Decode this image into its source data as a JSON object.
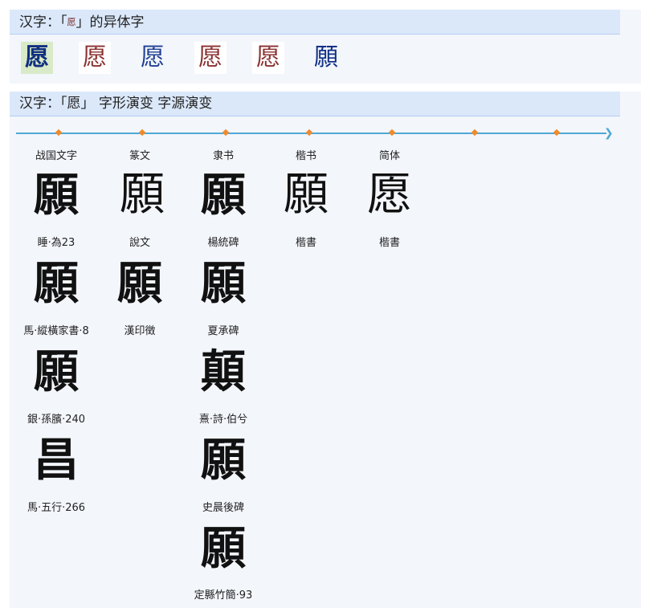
{
  "variants_section": {
    "title_prefix": "汉字：「",
    "title_char": "愿",
    "title_suffix": "」的异体字",
    "variants": [
      "愿",
      "愿",
      "愿",
      "愿",
      "愿",
      "願"
    ]
  },
  "evolution_section": {
    "title": "汉字：「愿」 字形演变 字源演变",
    "timeline_stops": 7,
    "eras": [
      "战国文字",
      "篆文",
      "隶书",
      "楷书",
      "简体"
    ],
    "forms": [
      {
        "glyph": "願",
        "caption": "睡·為23"
      },
      {
        "glyph": "願",
        "caption": "說文"
      },
      {
        "glyph": "願",
        "caption": "楊統碑"
      },
      {
        "glyph": "願",
        "caption": "楷書"
      },
      {
        "glyph": "愿",
        "caption": "楷書"
      },
      {
        "glyph": "願",
        "caption": "馬·縱橫家書·8"
      },
      {
        "glyph": "願",
        "caption": "漢印徵"
      },
      {
        "glyph": "願",
        "caption": "夏承碑"
      },
      {
        "glyph": "願",
        "caption": "銀·孫臏·240"
      },
      {
        "glyph": "顛",
        "caption": "熹·詩·伯兮"
      },
      {
        "glyph": "昌",
        "caption": "馬·五行·266"
      },
      {
        "glyph": "願",
        "caption": "史晨後碑"
      },
      {
        "glyph": "願",
        "caption": "定縣竹簡·93"
      }
    ]
  },
  "colors": {
    "header_bg": "#dbe8fa",
    "panel_bg": "#f3f6fb",
    "timeline": "#4fa8d6",
    "timeline_dot": "#f08a2a",
    "selected_variant_bg": "#d9eac9"
  }
}
